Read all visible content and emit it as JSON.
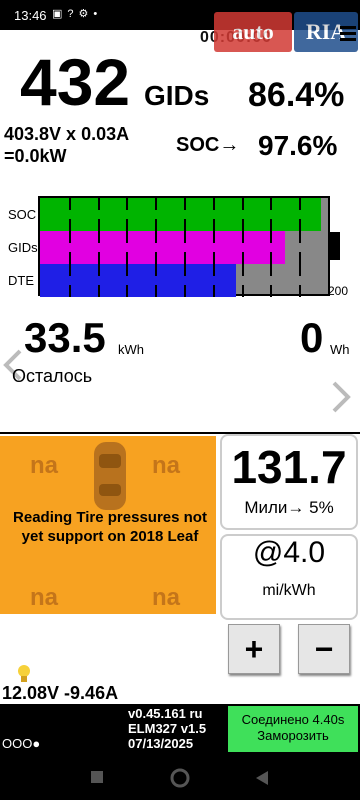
{
  "status_bar": {
    "time": "13:46",
    "icons": [
      "gallery-icon",
      "help-icon",
      "settings-icon",
      "dot-icon"
    ]
  },
  "watermark": {
    "part1": "auto",
    "part2": "RIA"
  },
  "header": {
    "clock": "00:00:00"
  },
  "battery": {
    "gids_value": "432",
    "gids_label": "GIDs",
    "percent": "86.4%",
    "voltage_current": "403.8V x 0.03A",
    "power": "=0.0kW",
    "soc_label": "SOC→",
    "soc_value": "97.6%"
  },
  "bar_chart": {
    "labels": [
      "SOC",
      "GIDs",
      "DTE"
    ],
    "fractions": [
      0.976,
      0.85,
      0.68
    ],
    "colors": [
      "#00b400",
      "#e100e1",
      "#1f1fe6"
    ],
    "dte_max": "200"
  },
  "energy": {
    "remaining_value": "33.5",
    "remaining_unit": "kWh",
    "remaining_label": "Осталось",
    "charge_value": "0",
    "charge_unit": "Wh"
  },
  "tires": {
    "fl": "na",
    "fr": "na",
    "rl": "na",
    "rr": "na",
    "message": "Reading Tire pressures not yet support on 2018 Leaf"
  },
  "range": {
    "value": "131.7",
    "unit": "Мили→ 5%"
  },
  "efficiency": {
    "value": "@4.0",
    "unit": "mi/kWh"
  },
  "controls": {
    "plus": "+",
    "minus": "−"
  },
  "aux_battery": {
    "value": "12.08V -9.46A"
  },
  "footer": {
    "version": "v0.45.161 ru",
    "adapter": "ELM327 v1.5",
    "date": "07/13/2025",
    "dots": "OOO●",
    "connected_line1": "Соединено 4.40s",
    "connected_line2": "Заморозить"
  }
}
